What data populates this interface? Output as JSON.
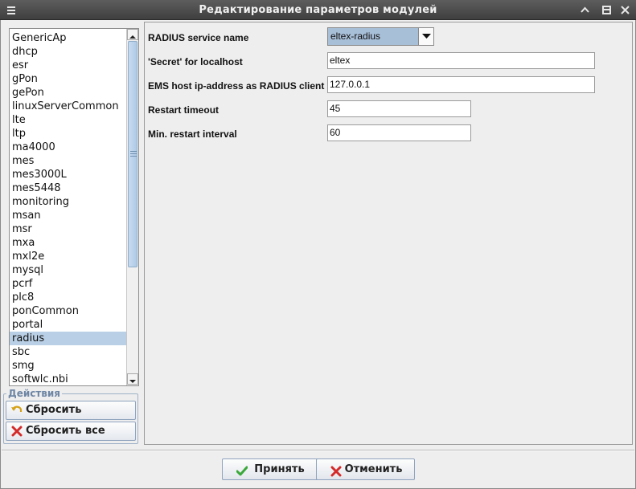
{
  "window": {
    "title": "Редактирование параметров модулей",
    "icons": [
      "menu-icon",
      "window-up-icon",
      "window-restore-icon",
      "window-close-icon"
    ]
  },
  "modules": {
    "items": [
      {
        "label": "GenericAp"
      },
      {
        "label": "dhcp"
      },
      {
        "label": "esr"
      },
      {
        "label": "gPon"
      },
      {
        "label": "gePon"
      },
      {
        "label": "linuxServerCommon"
      },
      {
        "label": "lte"
      },
      {
        "label": "ltp"
      },
      {
        "label": "ma4000"
      },
      {
        "label": "mes"
      },
      {
        "label": "mes3000L"
      },
      {
        "label": "mes5448"
      },
      {
        "label": "monitoring"
      },
      {
        "label": "msan"
      },
      {
        "label": "msr"
      },
      {
        "label": "mxa"
      },
      {
        "label": "mxl2e"
      },
      {
        "label": "mysql"
      },
      {
        "label": "pcrf"
      },
      {
        "label": "plc8"
      },
      {
        "label": "ponCommon"
      },
      {
        "label": "portal"
      },
      {
        "label": "radius",
        "selected": true
      },
      {
        "label": "sbc"
      },
      {
        "label": "smg"
      },
      {
        "label": "softwlc.nbi"
      }
    ],
    "selected": "radius"
  },
  "actions": {
    "legend": "Действия",
    "reset_label": "Сбросить",
    "reset_all_label": "Сбросить все"
  },
  "form": {
    "service_name": {
      "label": "RADIUS service name",
      "value": "eltex-radius"
    },
    "secret": {
      "label": "'Secret' for localhost",
      "value": "eltex"
    },
    "ems_host": {
      "label": "EMS host ip-address as RADIUS client",
      "value": "127.0.0.1"
    },
    "restart_timeout": {
      "label": "Restart timeout",
      "value": "45"
    },
    "min_restart_interval": {
      "label": "Min. restart interval",
      "value": "60"
    }
  },
  "footer": {
    "accept_label": "Принять",
    "cancel_label": "Отменить"
  },
  "colors": {
    "titlebar": "#4a4a4a",
    "selection": "#b8cfe5",
    "legend": "#6e86a4",
    "accept_icon": "#3aa83a",
    "cancel_icon": "#d42a2a"
  }
}
